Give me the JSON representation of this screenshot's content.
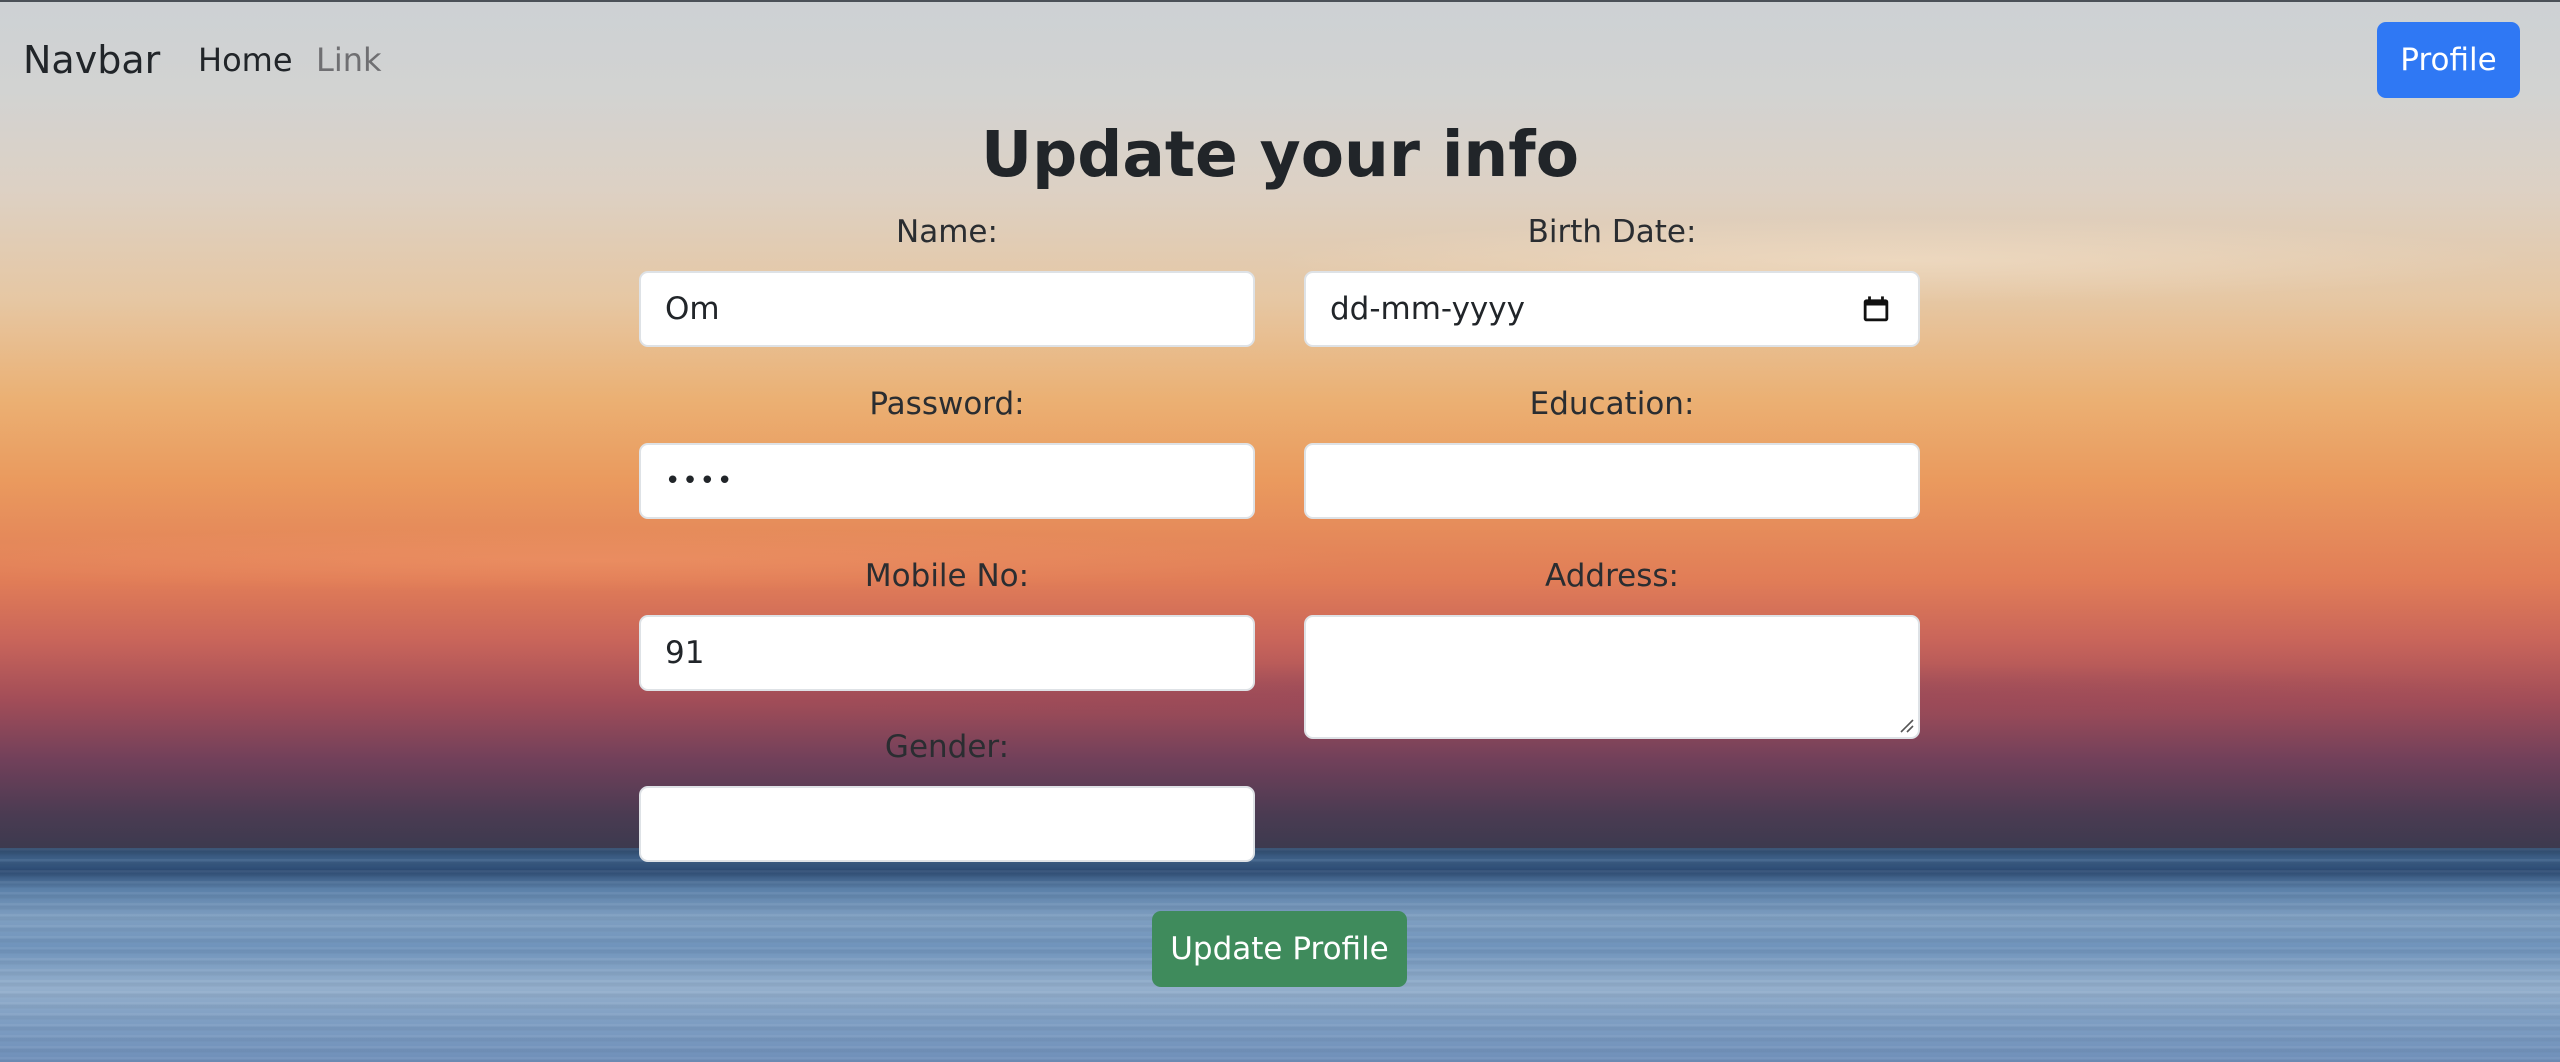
{
  "navbar": {
    "brand": "Navbar",
    "links": [
      "Home",
      "Link"
    ],
    "profile_button": "Profile"
  },
  "form": {
    "title": "Update your info",
    "name": {
      "label": "Name:",
      "value": "Om"
    },
    "birth_date": {
      "label": "Birth Date:",
      "value": "dd-mm-yyyy"
    },
    "password": {
      "label": "Password:",
      "value": "••••"
    },
    "education": {
      "label": "Education:",
      "value": ""
    },
    "mobile": {
      "label": "Mobile No:",
      "value": "91"
    },
    "address": {
      "label": "Address:",
      "value": ""
    },
    "gender": {
      "label": "Gender:",
      "value": ""
    },
    "submit_label": "Update Profile"
  },
  "icons": {
    "date_picker": "calendar-icon",
    "textarea_resize": "resize-grip-icon"
  },
  "colors": {
    "primary_button": "#2f78f4",
    "success_button": "#3f8b5c"
  }
}
